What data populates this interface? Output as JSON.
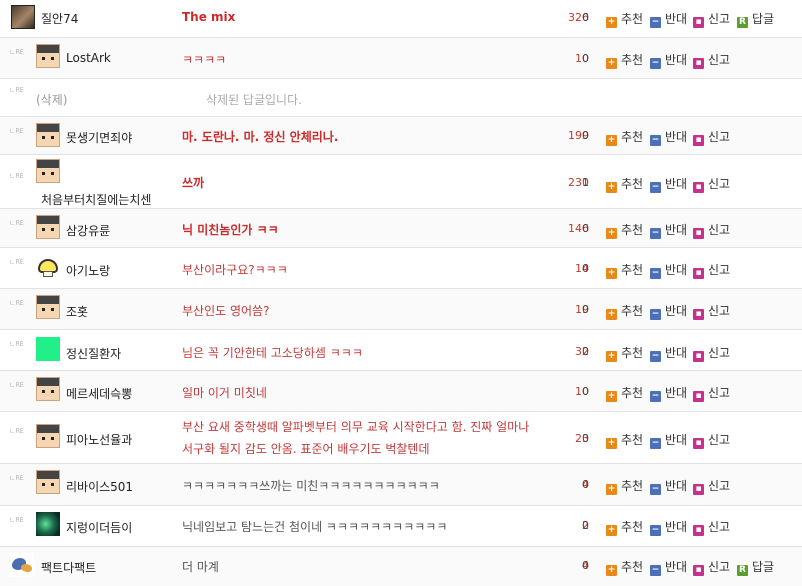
{
  "labels": {
    "re": "ㄴRE",
    "recommend": "추천",
    "oppose": "반대",
    "report": "신고",
    "reply": "답글",
    "plus_icon": "+",
    "minus_icon": "−",
    "report_icon": "▪",
    "reply_icon": "R"
  },
  "colors": {
    "recommend_icon": "#e8891c",
    "oppose_icon": "#4d6fb8",
    "report_icon": "#c4318f",
    "reply_icon": "#5a9f2d",
    "content_red": "#cc2a2a",
    "upvote_count": "#c0392b"
  },
  "comments": [
    {
      "nick": "질안74",
      "avatar": "photo-avatar",
      "content": "The mix",
      "up": "326",
      "down": "0"
    },
    {
      "nick": "LostArk",
      "avatar": "pixel-avatar",
      "content": "ㅋㅋㅋㅋ",
      "up": "10",
      "down": "0"
    },
    {
      "nick": "(삭제)",
      "content": "삭제된 답글입니다."
    },
    {
      "nick": "못생기면죄야",
      "avatar": "pixel-avatar",
      "content": "마. 도란나. 마. 정신 안체리나.",
      "up": "199",
      "down": "0"
    },
    {
      "nick": "처음부터치질에는치센",
      "avatar": "pixel-avatar",
      "content": "쓰까",
      "up": "230",
      "down": "1"
    },
    {
      "nick": "삼강유륜",
      "avatar": "pixel-avatar",
      "content": "닉 미친놈인가 ㅋㅋ",
      "up": "146",
      "down": "0"
    },
    {
      "nick": "아기노랑",
      "avatar": "yellow-avatar",
      "content": "부산이라구요?ㅋㅋㅋ",
      "up": "14",
      "down": "0"
    },
    {
      "nick": "조홋",
      "avatar": "pixel-avatar",
      "content": "부산인도 영어씀?",
      "up": "19",
      "down": "0"
    },
    {
      "nick": "정신질환자",
      "avatar": "green-avatar",
      "content": "님은 꼭 기안한테 고소당하셈 ㅋㅋㅋ",
      "up": "32",
      "down": "0"
    },
    {
      "nick": "메르세데슥뽕",
      "avatar": "pixel-avatar",
      "content": "일마 이거 미칫네",
      "up": "10",
      "down": "0"
    },
    {
      "nick": "피아노선율과",
      "avatar": "pixel-avatar",
      "content_line1": "부산 요새 중학생때 알파벳부터 의무 교육 시작한다고 함. 진짜 얼마나",
      "content_line2": "서구화 될지 감도 안옴. 표준어 배우기도 벅찰텐데",
      "up": "23",
      "down": "0"
    },
    {
      "nick": "리바이스501",
      "avatar": "pixel-avatar",
      "content": "ㅋㅋㅋㅋㅋㅋㅋ쓰까는 미친ㅋㅋㅋㅋㅋㅋㅋㅋㅋㅋㅋ",
      "up": "4",
      "down": "0"
    },
    {
      "nick": "지렁이더듬이",
      "avatar": "dark-avatar",
      "content": "닉네임보고 탐느는건 첨이네 ㅋㅋㅋㅋㅋㅋㅋㅋㅋㅋㅋ",
      "up": "2",
      "down": "0"
    },
    {
      "nick": "팩트다팩트",
      "avatar": "bird-avatar",
      "content": "더 마계",
      "up": "4",
      "down": "0"
    }
  ]
}
